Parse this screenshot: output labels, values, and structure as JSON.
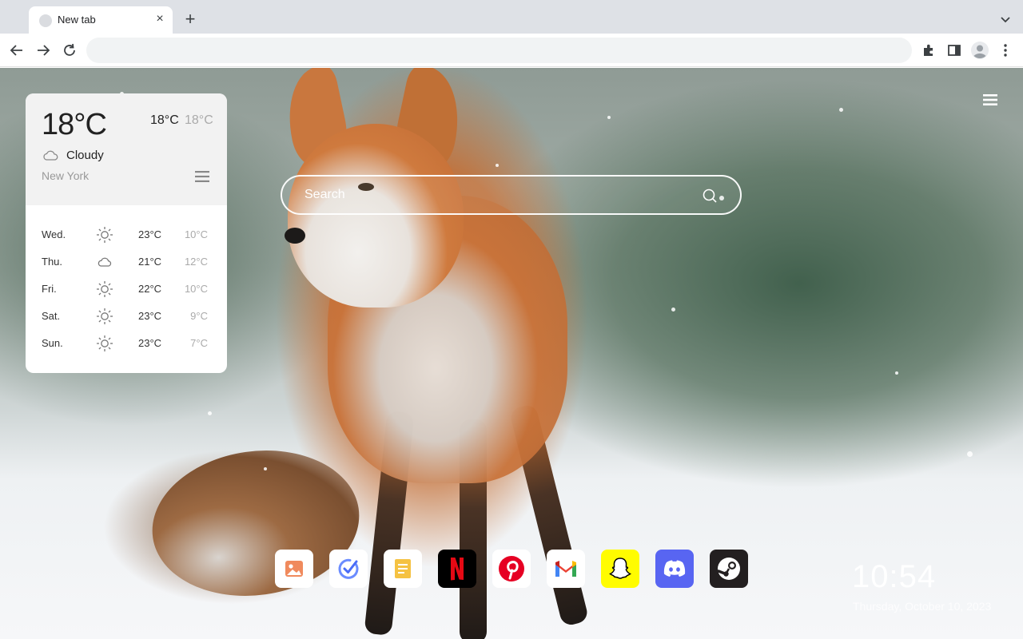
{
  "browser": {
    "tab_title": "New tab",
    "tab_close": "×",
    "new_tab_label": "+",
    "omnibox_value": "",
    "icons": [
      "back-icon",
      "forward-icon",
      "reload-icon",
      "extensions-icon",
      "side-panel-icon",
      "profile-icon",
      "more-icon"
    ]
  },
  "weather": {
    "current_temp": "18°C",
    "high": "18°C",
    "low": "18°C",
    "condition": "Cloudy",
    "condition_icon": "cloud-icon",
    "city": "New York",
    "forecast": [
      {
        "day": "Wed.",
        "icon": "sun-icon",
        "high": "23°C",
        "low": "10°C"
      },
      {
        "day": "Thu.",
        "icon": "cloud-icon",
        "high": "21°C",
        "low": "12°C"
      },
      {
        "day": "Fri.",
        "icon": "sun-icon",
        "high": "22°C",
        "low": "10°C"
      },
      {
        "day": "Sat.",
        "icon": "sun-icon",
        "high": "23°C",
        "low": "9°C"
      },
      {
        "day": "Sun.",
        "icon": "sun-icon",
        "high": "23°C",
        "low": "7°C"
      }
    ]
  },
  "search": {
    "placeholder": "Search"
  },
  "dock": [
    {
      "name": "photos",
      "icon": "photos-icon",
      "color": "#ffffff"
    },
    {
      "name": "todo",
      "icon": "checkmark-icon",
      "color": "#ffffff"
    },
    {
      "name": "notes",
      "icon": "notes-icon",
      "color": "#ffffff"
    },
    {
      "name": "netflix",
      "icon": "netflix-icon",
      "color": "#000000"
    },
    {
      "name": "pinterest",
      "icon": "pinterest-icon",
      "color": "#ffffff"
    },
    {
      "name": "gmail",
      "icon": "gmail-icon",
      "color": "#ffffff"
    },
    {
      "name": "snapchat",
      "icon": "snapchat-icon",
      "color": "#fffc00"
    },
    {
      "name": "discord",
      "icon": "discord-icon",
      "color": "#5865f2"
    },
    {
      "name": "steam",
      "icon": "steam-icon",
      "color": "#231f20"
    }
  ],
  "clock": {
    "time": "10:54",
    "date": "Thursday, October 10, 2023"
  }
}
